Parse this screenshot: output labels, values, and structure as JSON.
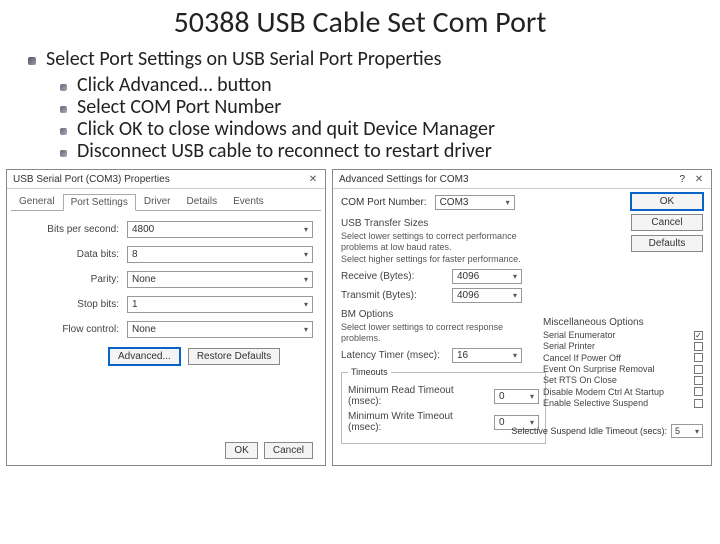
{
  "title": "50388 USB Cable Set Com Port",
  "bullets": {
    "main": "Select Port Settings on USB Serial Port Properties",
    "subs": [
      "Click Advanced… button",
      "Select COM Port Number",
      "Click OK to close windows and quit Device Manager",
      "Disconnect USB cable to reconnect to restart driver"
    ]
  },
  "win1": {
    "title": "USB Serial Port (COM3) Properties",
    "tabs": [
      "General",
      "Port Settings",
      "Driver",
      "Details",
      "Events"
    ],
    "activeTab": 1,
    "fields": {
      "bps_label": "Bits per second:",
      "bps_value": "4800",
      "databits_label": "Data bits:",
      "databits_value": "8",
      "parity_label": "Parity:",
      "parity_value": "None",
      "stopbits_label": "Stop bits:",
      "stopbits_value": "1",
      "flow_label": "Flow control:",
      "flow_value": "None"
    },
    "advanced": "Advanced...",
    "restore": "Restore Defaults",
    "ok": "OK",
    "cancel": "Cancel"
  },
  "win2": {
    "title": "Advanced Settings for COM3",
    "comport_label": "COM Port Number:",
    "comport_value": "COM3",
    "usb_sizes_label": "USB Transfer Sizes",
    "usb_note1": "Select lower settings to correct performance problems at low baud rates.",
    "usb_note2": "Select higher settings for faster performance.",
    "rx_label": "Receive (Bytes):",
    "rx_value": "4096",
    "tx_label": "Transmit (Bytes):",
    "tx_value": "4096",
    "bm_label": "BM Options",
    "bm_note": "Select lower settings to correct response problems.",
    "lat_label": "Latency Timer (msec):",
    "lat_value": "16",
    "timeouts_label": "Timeouts",
    "min_read_label": "Minimum Read Timeout (msec):",
    "min_read_value": "0",
    "min_write_label": "Minimum Write Timeout (msec):",
    "min_write_value": "0",
    "ok": "OK",
    "cancel": "Cancel",
    "defaults": "Defaults",
    "misc_label": "Miscellaneous Options",
    "misc": [
      {
        "label": "Serial Enumerator",
        "checked": true
      },
      {
        "label": "Serial Printer",
        "checked": false
      },
      {
        "label": "Cancel If Power Off",
        "checked": false
      },
      {
        "label": "Event On Surprise Removal",
        "checked": false
      },
      {
        "label": "Set RTS On Close",
        "checked": false
      },
      {
        "label": "Disable Modem Ctrl At Startup",
        "checked": false
      },
      {
        "label": "Enable Selective Suspend",
        "checked": false
      }
    ],
    "idle_label": "Selective Suspend Idle Timeout (secs):",
    "idle_value": "5"
  }
}
